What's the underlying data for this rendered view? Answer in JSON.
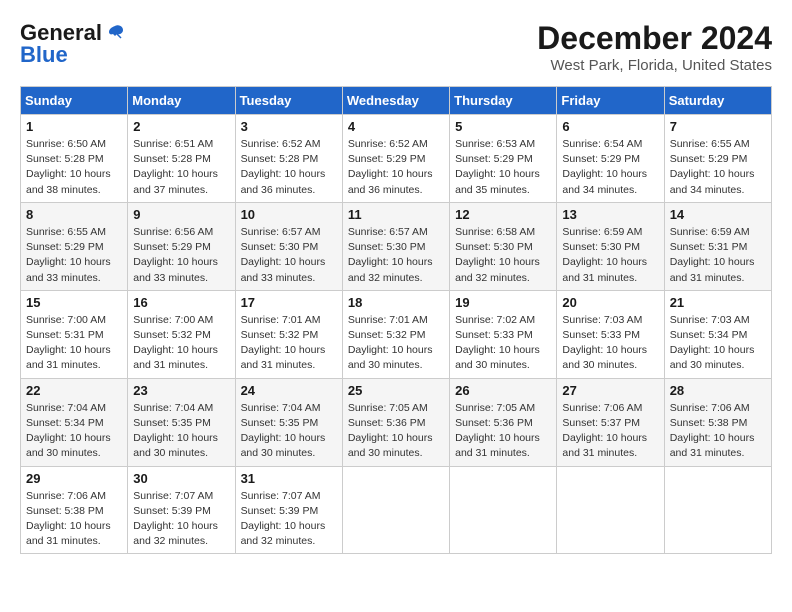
{
  "header": {
    "logo_general": "General",
    "logo_blue": "Blue",
    "title": "December 2024",
    "location": "West Park, Florida, United States"
  },
  "calendar": {
    "days_of_week": [
      "Sunday",
      "Monday",
      "Tuesday",
      "Wednesday",
      "Thursday",
      "Friday",
      "Saturday"
    ],
    "weeks": [
      [
        {
          "day": "1",
          "sunrise": "6:50 AM",
          "sunset": "5:28 PM",
          "daylight": "10 hours and 38 minutes."
        },
        {
          "day": "2",
          "sunrise": "6:51 AM",
          "sunset": "5:28 PM",
          "daylight": "10 hours and 37 minutes."
        },
        {
          "day": "3",
          "sunrise": "6:52 AM",
          "sunset": "5:28 PM",
          "daylight": "10 hours and 36 minutes."
        },
        {
          "day": "4",
          "sunrise": "6:52 AM",
          "sunset": "5:29 PM",
          "daylight": "10 hours and 36 minutes."
        },
        {
          "day": "5",
          "sunrise": "6:53 AM",
          "sunset": "5:29 PM",
          "daylight": "10 hours and 35 minutes."
        },
        {
          "day": "6",
          "sunrise": "6:54 AM",
          "sunset": "5:29 PM",
          "daylight": "10 hours and 34 minutes."
        },
        {
          "day": "7",
          "sunrise": "6:55 AM",
          "sunset": "5:29 PM",
          "daylight": "10 hours and 34 minutes."
        }
      ],
      [
        {
          "day": "8",
          "sunrise": "6:55 AM",
          "sunset": "5:29 PM",
          "daylight": "10 hours and 33 minutes."
        },
        {
          "day": "9",
          "sunrise": "6:56 AM",
          "sunset": "5:29 PM",
          "daylight": "10 hours and 33 minutes."
        },
        {
          "day": "10",
          "sunrise": "6:57 AM",
          "sunset": "5:30 PM",
          "daylight": "10 hours and 33 minutes."
        },
        {
          "day": "11",
          "sunrise": "6:57 AM",
          "sunset": "5:30 PM",
          "daylight": "10 hours and 32 minutes."
        },
        {
          "day": "12",
          "sunrise": "6:58 AM",
          "sunset": "5:30 PM",
          "daylight": "10 hours and 32 minutes."
        },
        {
          "day": "13",
          "sunrise": "6:59 AM",
          "sunset": "5:30 PM",
          "daylight": "10 hours and 31 minutes."
        },
        {
          "day": "14",
          "sunrise": "6:59 AM",
          "sunset": "5:31 PM",
          "daylight": "10 hours and 31 minutes."
        }
      ],
      [
        {
          "day": "15",
          "sunrise": "7:00 AM",
          "sunset": "5:31 PM",
          "daylight": "10 hours and 31 minutes."
        },
        {
          "day": "16",
          "sunrise": "7:00 AM",
          "sunset": "5:32 PM",
          "daylight": "10 hours and 31 minutes."
        },
        {
          "day": "17",
          "sunrise": "7:01 AM",
          "sunset": "5:32 PM",
          "daylight": "10 hours and 31 minutes."
        },
        {
          "day": "18",
          "sunrise": "7:01 AM",
          "sunset": "5:32 PM",
          "daylight": "10 hours and 30 minutes."
        },
        {
          "day": "19",
          "sunrise": "7:02 AM",
          "sunset": "5:33 PM",
          "daylight": "10 hours and 30 minutes."
        },
        {
          "day": "20",
          "sunrise": "7:03 AM",
          "sunset": "5:33 PM",
          "daylight": "10 hours and 30 minutes."
        },
        {
          "day": "21",
          "sunrise": "7:03 AM",
          "sunset": "5:34 PM",
          "daylight": "10 hours and 30 minutes."
        }
      ],
      [
        {
          "day": "22",
          "sunrise": "7:04 AM",
          "sunset": "5:34 PM",
          "daylight": "10 hours and 30 minutes."
        },
        {
          "day": "23",
          "sunrise": "7:04 AM",
          "sunset": "5:35 PM",
          "daylight": "10 hours and 30 minutes."
        },
        {
          "day": "24",
          "sunrise": "7:04 AM",
          "sunset": "5:35 PM",
          "daylight": "10 hours and 30 minutes."
        },
        {
          "day": "25",
          "sunrise": "7:05 AM",
          "sunset": "5:36 PM",
          "daylight": "10 hours and 30 minutes."
        },
        {
          "day": "26",
          "sunrise": "7:05 AM",
          "sunset": "5:36 PM",
          "daylight": "10 hours and 31 minutes."
        },
        {
          "day": "27",
          "sunrise": "7:06 AM",
          "sunset": "5:37 PM",
          "daylight": "10 hours and 31 minutes."
        },
        {
          "day": "28",
          "sunrise": "7:06 AM",
          "sunset": "5:38 PM",
          "daylight": "10 hours and 31 minutes."
        }
      ],
      [
        {
          "day": "29",
          "sunrise": "7:06 AM",
          "sunset": "5:38 PM",
          "daylight": "10 hours and 31 minutes."
        },
        {
          "day": "30",
          "sunrise": "7:07 AM",
          "sunset": "5:39 PM",
          "daylight": "10 hours and 32 minutes."
        },
        {
          "day": "31",
          "sunrise": "7:07 AM",
          "sunset": "5:39 PM",
          "daylight": "10 hours and 32 minutes."
        },
        null,
        null,
        null,
        null
      ]
    ]
  },
  "labels": {
    "sunrise": "Sunrise:",
    "sunset": "Sunset:",
    "daylight": "Daylight:"
  }
}
